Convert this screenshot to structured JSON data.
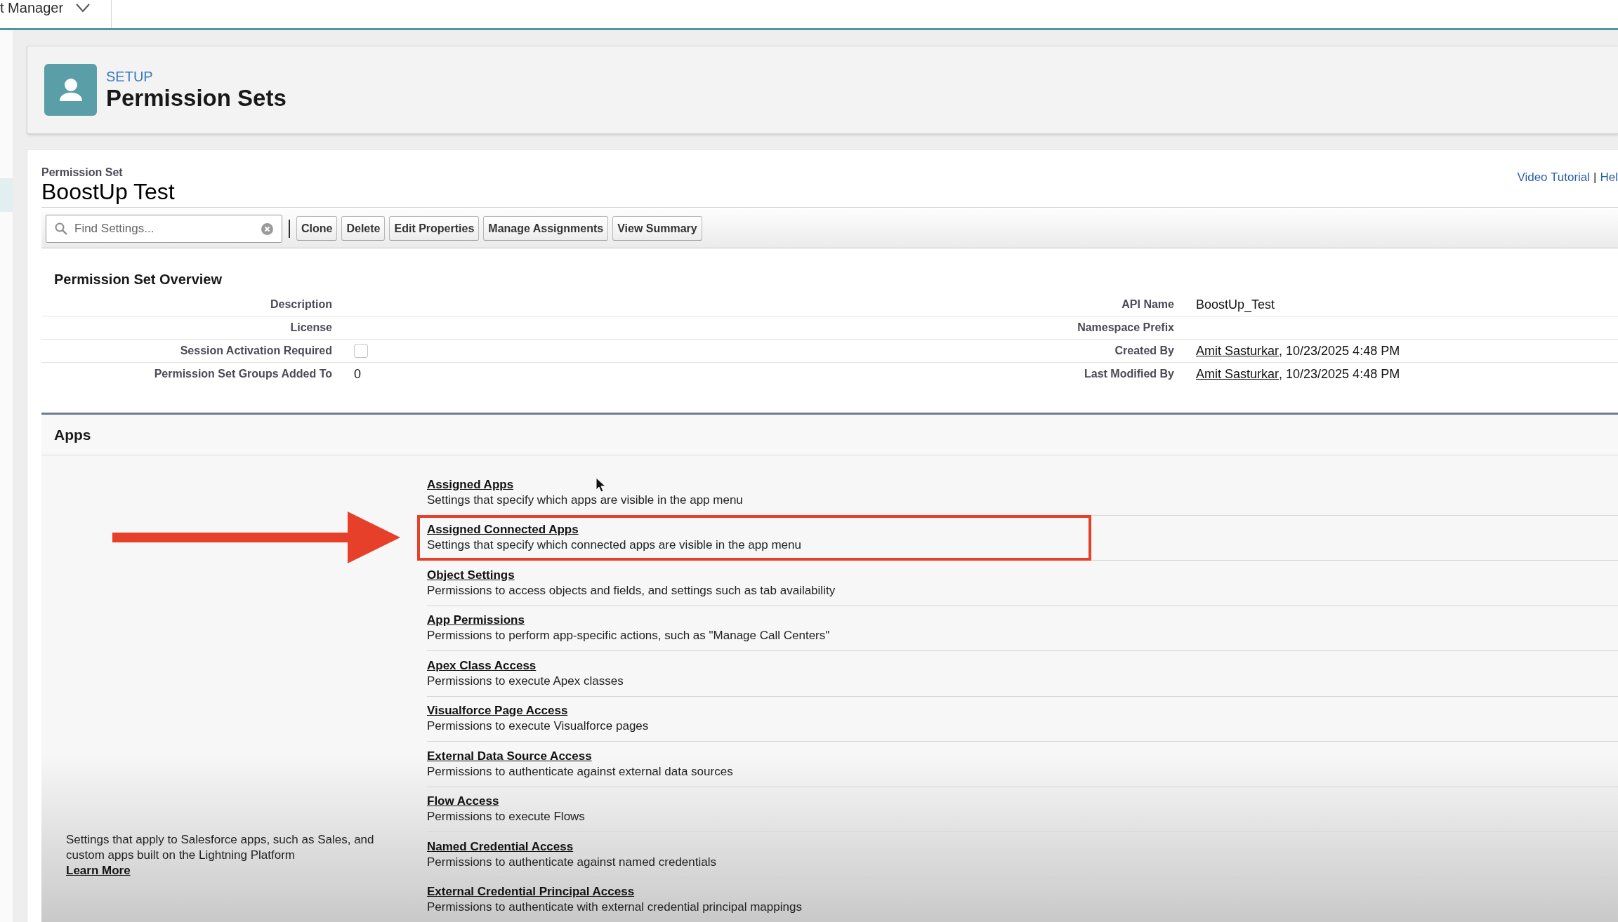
{
  "top_bar": {
    "app_name": "t Manager"
  },
  "header": {
    "eyebrow": "SETUP",
    "title": "Permission Sets"
  },
  "record": {
    "label": "Permission Set",
    "name": "BoostUp Test",
    "help_links": [
      {
        "label": "Video Tutorial"
      },
      {
        "label": "Hel"
      }
    ],
    "help_separator": "|"
  },
  "toolbar": {
    "search": {
      "placeholder": "Find Settings..."
    },
    "buttons": [
      "Clone",
      "Delete",
      "Edit Properties",
      "Manage Assignments",
      "View Summary"
    ]
  },
  "overview": {
    "title": "Permission Set Overview",
    "rows": [
      {
        "left": {
          "label": "Description",
          "kind": "text"
        },
        "right": {
          "label": "API Name",
          "kind": "text",
          "value": "BoostUp_Test"
        }
      },
      {
        "left": {
          "label": "License",
          "kind": "text"
        },
        "right": {
          "label": "Namespace Prefix",
          "kind": "text"
        }
      },
      {
        "left": {
          "label": "Session Activation Required",
          "kind": "checkbox",
          "checked": false
        },
        "right": {
          "label": "Created By",
          "kind": "user",
          "user": "Amit Sasturkar",
          "timestamp": ", 10/23/2025 4:48 PM"
        }
      },
      {
        "left": {
          "label": "Permission Set Groups Added To",
          "kind": "text",
          "value": "0"
        },
        "right": {
          "label": "Last Modified By",
          "kind": "user",
          "user": "Amit Sasturkar",
          "timestamp": ", 10/23/2025 4:48 PM"
        }
      }
    ]
  },
  "apps": {
    "title": "Apps",
    "description": "Settings that apply to Salesforce apps, such as Sales, and custom apps built on the Lightning Platform",
    "learn_more": "Learn More",
    "items": [
      {
        "title": "Assigned Apps",
        "description": "Settings that specify which apps are visible in the app menu",
        "highlighted": false
      },
      {
        "title": "Assigned Connected Apps",
        "description": "Settings that specify which connected apps are visible in the app menu",
        "highlighted": true
      },
      {
        "title": "Object Settings",
        "description": "Permissions to access objects and fields, and settings such as tab availability",
        "highlighted": false
      },
      {
        "title": "App Permissions",
        "description": "Permissions to perform app-specific actions, such as \"Manage Call Centers\"",
        "highlighted": false
      },
      {
        "title": "Apex Class Access",
        "description": "Permissions to execute Apex classes",
        "highlighted": false
      },
      {
        "title": "Visualforce Page Access",
        "description": "Permissions to execute Visualforce pages",
        "highlighted": false
      },
      {
        "title": "External Data Source Access",
        "description": "Permissions to authenticate against external data sources",
        "highlighted": false
      },
      {
        "title": "Flow Access",
        "description": "Permissions to execute Flows",
        "highlighted": false
      },
      {
        "title": "Named Credential Access",
        "description": "Permissions to authenticate against named credentials",
        "highlighted": false
      },
      {
        "title": "External Credential Principal Access",
        "description": "Permissions to authenticate with external credential principal mappings",
        "highlighted": false
      }
    ]
  }
}
